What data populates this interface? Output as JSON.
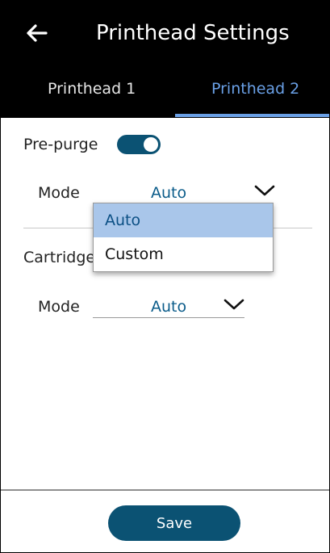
{
  "header": {
    "title": "Printhead Settings",
    "back_icon": "arrow-left-icon"
  },
  "tabs": [
    {
      "label": "Printhead 1",
      "active": false
    },
    {
      "label": "Printhead 2",
      "active": true
    }
  ],
  "prepurge": {
    "label": "Pre-purge",
    "enabled": true,
    "mode_label": "Mode",
    "mode_value": "Auto",
    "dropdown_open": true,
    "options": [
      "Auto",
      "Custom"
    ],
    "highlighted_option": "Auto"
  },
  "cartridge": {
    "label": "Cartridge",
    "mode_label": "Mode",
    "mode_value": "Auto"
  },
  "footer": {
    "save_label": "Save"
  },
  "colors": {
    "header_bg": "#000000",
    "accent_blue": "#6aa0e6",
    "primary_teal": "#0b5273",
    "value_blue": "#0b5c8a",
    "option_highlight": "#a9c6ea"
  }
}
